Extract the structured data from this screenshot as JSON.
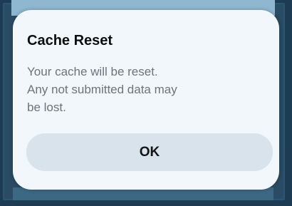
{
  "dialog": {
    "title": "Cache Reset",
    "message": "Your cache will be reset.\n Any not submitted data may\nbe lost.",
    "ok_label": "OK"
  },
  "colors": {
    "background": "#1d3b52",
    "dialog_bg": "#f1f7fb",
    "button_bg": "#d9e3eb",
    "title_text": "#0d0d0d",
    "message_text": "#6d7379"
  }
}
